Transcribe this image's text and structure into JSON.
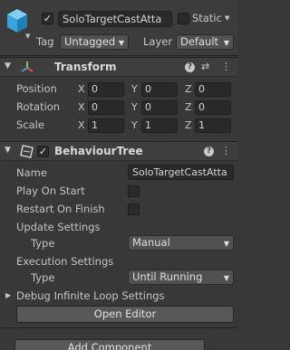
{
  "gameobject": {
    "name": "SoloTargetCastAtta",
    "active_checked": true,
    "static_label": "Static",
    "tag_label": "Tag",
    "tag_value": "Untagged",
    "layer_label": "Layer",
    "layer_value": "Default"
  },
  "transform": {
    "title": "Transform",
    "rows": [
      {
        "label": "Position",
        "x": "0",
        "y": "0",
        "z": "0"
      },
      {
        "label": "Rotation",
        "x": "0",
        "y": "0",
        "z": "0"
      },
      {
        "label": "Scale",
        "x": "1",
        "y": "1",
        "z": "1"
      }
    ],
    "axes": {
      "x": "X",
      "y": "Y",
      "z": "Z"
    }
  },
  "behaviour_tree": {
    "title": "BehaviourTree",
    "name_label": "Name",
    "name_value": "SoloTargetCastAtta",
    "play_on_start_label": "Play On Start",
    "restart_on_finish_label": "Restart On Finish",
    "update_settings_label": "Update Settings",
    "update_type_label": "Type",
    "update_type_value": "Manual",
    "execution_settings_label": "Execution Settings",
    "execution_type_label": "Type",
    "execution_type_value": "Until Running",
    "debug_label": "Debug Infinite Loop Settings",
    "open_editor_label": "Open Editor"
  },
  "add_component_label": "Add Component",
  "glyphs": {
    "check": "✓",
    "caret": "▼",
    "fold_open": "▼",
    "fold_closed": "▶",
    "help": "?",
    "presets": "⇄",
    "more": "⋮"
  }
}
